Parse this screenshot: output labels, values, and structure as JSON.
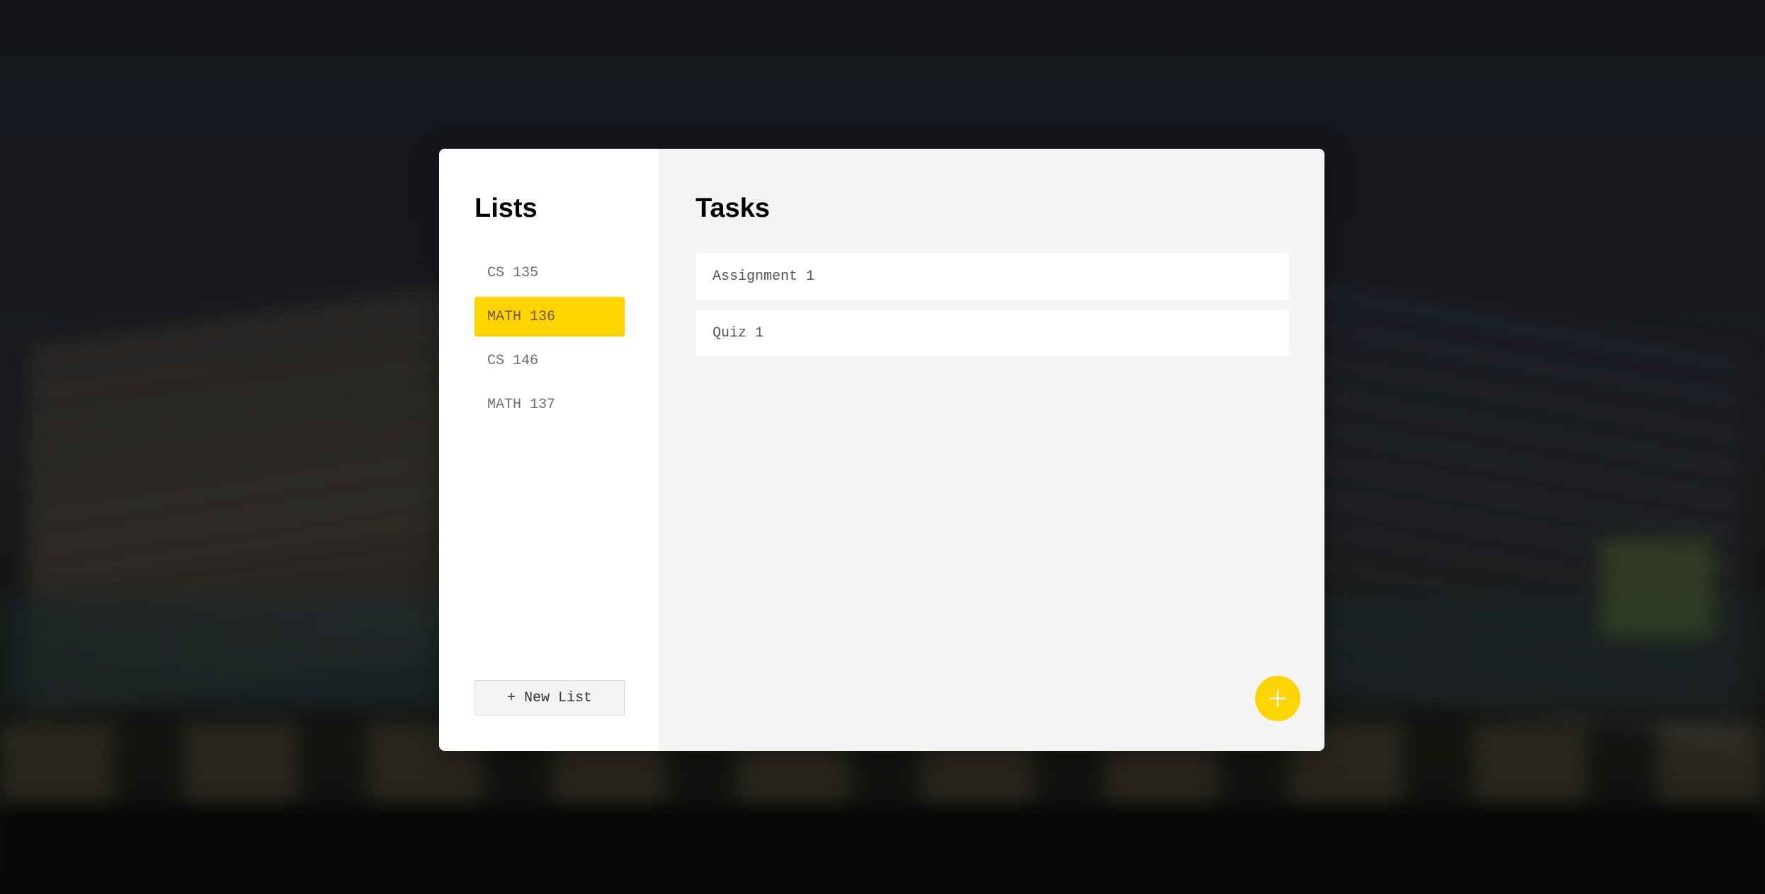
{
  "lists_panel": {
    "heading": "Lists",
    "items": [
      {
        "label": "CS 135",
        "active": false
      },
      {
        "label": "MATH 136",
        "active": true
      },
      {
        "label": "CS 146",
        "active": false
      },
      {
        "label": "MATH 137",
        "active": false
      }
    ],
    "new_list_label": "+ New List"
  },
  "tasks_panel": {
    "heading": "Tasks",
    "items": [
      {
        "label": "Assignment 1"
      },
      {
        "label": "Quiz 1"
      }
    ],
    "add_button_icon": "plus-icon"
  },
  "colors": {
    "accent": "#ffd400",
    "panel_bg": "#f4f4f4",
    "card_bg": "#ffffff"
  }
}
